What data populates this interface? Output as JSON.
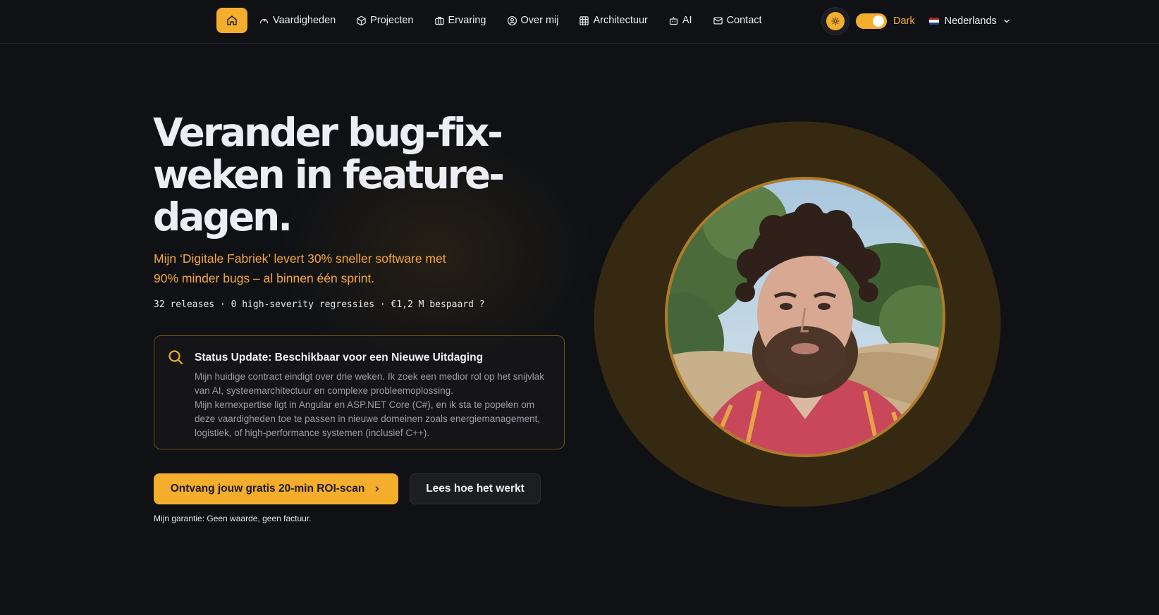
{
  "nav": {
    "home_icon": "home-icon",
    "items": [
      {
        "label": "Vaardigheden",
        "icon": "gauge-icon"
      },
      {
        "label": "Projecten",
        "icon": "box-icon"
      },
      {
        "label": "Ervaring",
        "icon": "briefcase-icon"
      },
      {
        "label": "Over mij",
        "icon": "user-circle-icon"
      },
      {
        "label": "Architectuur",
        "icon": "grid-icon"
      },
      {
        "label": "AI",
        "icon": "robot-icon"
      },
      {
        "label": "Contact",
        "icon": "mail-icon"
      }
    ]
  },
  "tools": {
    "theme_icon": "sun-icon",
    "theme_label": "Dark",
    "theme_dark_enabled": true,
    "language": "Nederlands"
  },
  "hero": {
    "title": "Verander bug-fix-weken in feature-dagen.",
    "subtitle": "Mijn ‘Digitale Fabriek’ levert 30% sneller software met 90% minder bugs – al binnen één sprint.",
    "stats": "32 releases · 0 high-severity regressies · €1,2 M bespaard  ?",
    "status": {
      "title": "Status Update: Beschikbaar voor een Nieuwe Uitdaging",
      "paragraph1": "Mijn huidige contract eindigt over drie weken. Ik zoek een medior rol op het snijvlak van AI, systeemarchitectuur en complexe probleemoplossing.",
      "paragraph2": "Mijn kernexpertise ligt in Angular en ASP.NET Core (C#), en ik sta te popelen om deze vaardigheden toe te passen in nieuwe domeinen zoals energiemanagement, logistiek, of high-performance systemen (inclusief C++)."
    },
    "cta_primary": "Ontvang jouw gratis 20-min ROI-scan",
    "cta_secondary": "Lees hoe het werkt",
    "guarantee": "Mijn garantie: Geen waarde, geen factuur."
  },
  "colors": {
    "accent": "#f5ad2c",
    "background": "#0f1115",
    "subtitle": "#f5a83c",
    "blob": "#3a2c12"
  }
}
